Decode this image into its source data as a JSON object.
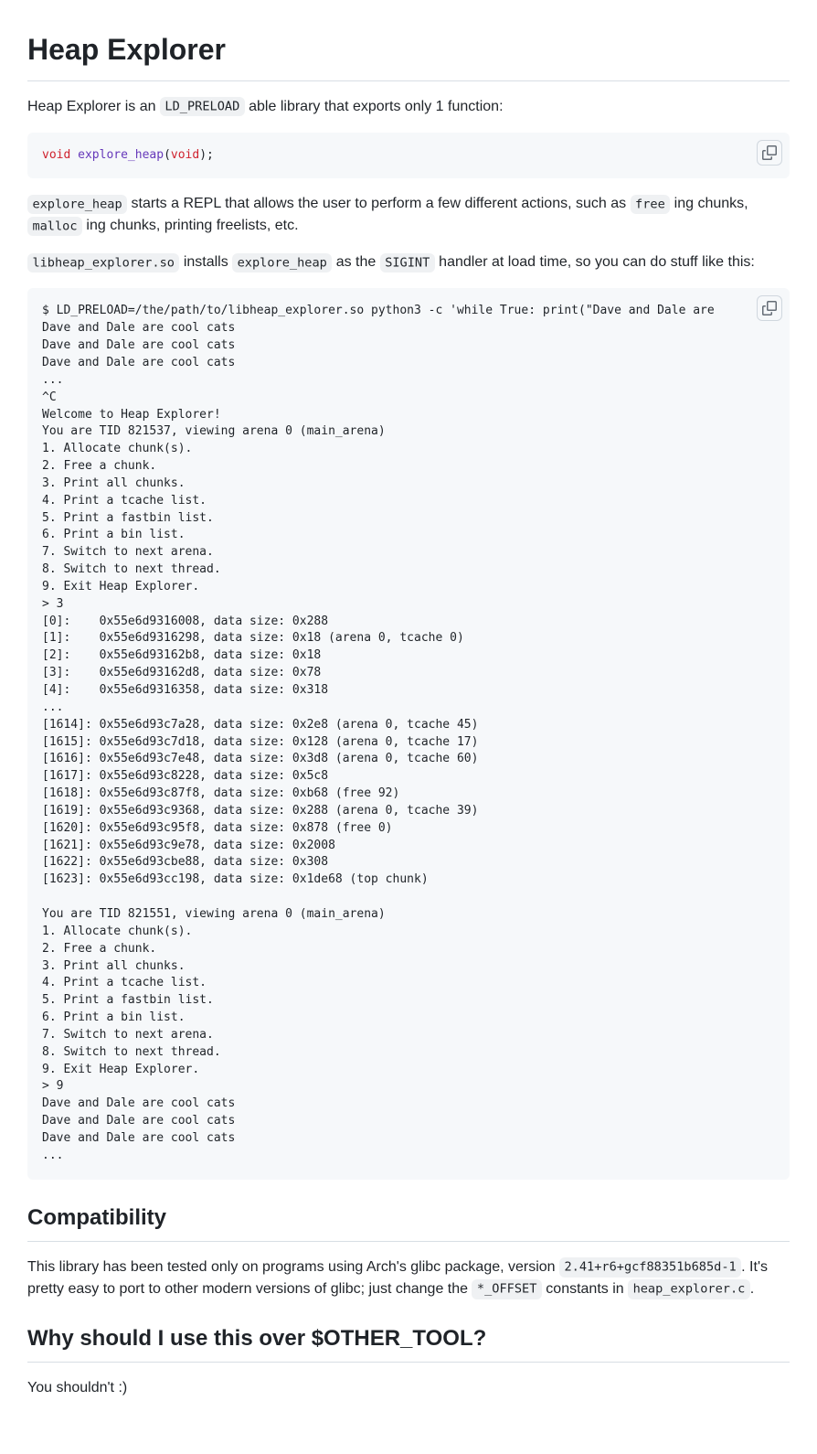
{
  "title": "Heap Explorer",
  "intro": {
    "p1_a": "Heap Explorer is an ",
    "p1_code": "LD_PRELOAD",
    "p1_b": " able library that exports only 1 function:"
  },
  "sig": {
    "k1": "void",
    "fn": "explore_heap",
    "paren_open": "(",
    "k2": "void",
    "paren_close": ");"
  },
  "p2": {
    "c1": "explore_heap",
    "t1": " starts a REPL that allows the user to perform a few different actions, such as ",
    "c2": "free",
    "t2": " ing chunks, ",
    "c3": "malloc",
    "t3": " ing chunks, printing freelists, etc."
  },
  "p3": {
    "c1": "libheap_explorer.so",
    "t1": " installs ",
    "c2": "explore_heap",
    "t2": " as the ",
    "c3": "SIGINT",
    "t3": " handler at load time, so you can do stuff like this:"
  },
  "session": "$ LD_PRELOAD=/the/path/to/libheap_explorer.so python3 -c 'while True: print(\"Dave and Dale are\nDave and Dale are cool cats\nDave and Dale are cool cats\nDave and Dale are cool cats\n...\n^C\nWelcome to Heap Explorer!\nYou are TID 821537, viewing arena 0 (main_arena)\n1. Allocate chunk(s).\n2. Free a chunk.\n3. Print all chunks.\n4. Print a tcache list.\n5. Print a fastbin list.\n6. Print a bin list.\n7. Switch to next arena.\n8. Switch to next thread.\n9. Exit Heap Explorer.\n> 3\n[0]:    0x55e6d9316008, data size: 0x288\n[1]:    0x55e6d9316298, data size: 0x18 (arena 0, tcache 0)\n[2]:    0x55e6d93162b8, data size: 0x18\n[3]:    0x55e6d93162d8, data size: 0x78\n[4]:    0x55e6d9316358, data size: 0x318\n...\n[1614]: 0x55e6d93c7a28, data size: 0x2e8 (arena 0, tcache 45)\n[1615]: 0x55e6d93c7d18, data size: 0x128 (arena 0, tcache 17)\n[1616]: 0x55e6d93c7e48, data size: 0x3d8 (arena 0, tcache 60)\n[1617]: 0x55e6d93c8228, data size: 0x5c8\n[1618]: 0x55e6d93c87f8, data size: 0xb68 (free 92)\n[1619]: 0x55e6d93c9368, data size: 0x288 (arena 0, tcache 39)\n[1620]: 0x55e6d93c95f8, data size: 0x878 (free 0)\n[1621]: 0x55e6d93c9e78, data size: 0x2008\n[1622]: 0x55e6d93cbe88, data size: 0x308\n[1623]: 0x55e6d93cc198, data size: 0x1de68 (top chunk)\n\nYou are TID 821551, viewing arena 0 (main_arena)\n1. Allocate chunk(s).\n2. Free a chunk.\n3. Print all chunks.\n4. Print a tcache list.\n5. Print a fastbin list.\n6. Print a bin list.\n7. Switch to next arena.\n8. Switch to next thread.\n9. Exit Heap Explorer.\n> 9\nDave and Dale are cool cats\nDave and Dale are cool cats\nDave and Dale are cool cats\n...",
  "compat": {
    "heading": "Compatibility",
    "t1": "This library has been tested only on programs using Arch's glibc package, version ",
    "c1": "2.41+r6+gcf88351b685d-1",
    "t2": ". It's pretty easy to port to other modern versions of glibc; just change the ",
    "c2": "*_OFFSET",
    "t3": " constants in ",
    "c3": "heap_explorer.c",
    "t4": "."
  },
  "why": {
    "heading": "Why should I use this over $OTHER_TOOL?",
    "body": "You shouldn't :)"
  }
}
